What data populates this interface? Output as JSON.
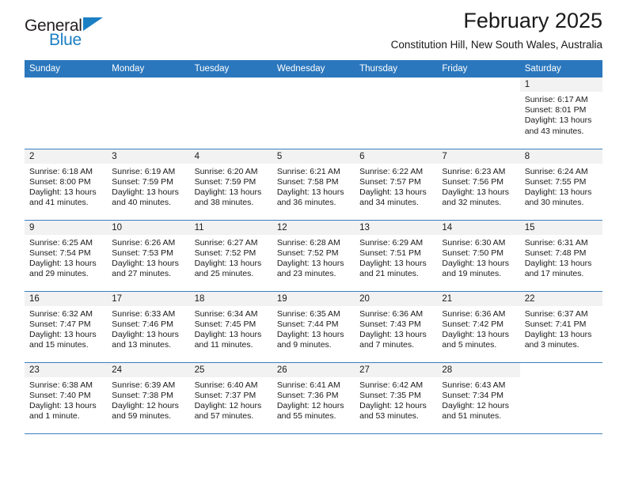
{
  "brand": {
    "name_top": "General",
    "name_bottom": "Blue",
    "flag_color": "#1b7fc4"
  },
  "header": {
    "title": "February 2025",
    "subtitle": "Constitution Hill, New South Wales, Australia"
  },
  "theme": {
    "header_row_bg": "#2b77bd",
    "daynum_bg": "#f2f2f2",
    "row_border": "#3a7fc0"
  },
  "weekday_headers": [
    "Sunday",
    "Monday",
    "Tuesday",
    "Wednesday",
    "Thursday",
    "Friday",
    "Saturday"
  ],
  "labels": {
    "sunrise_prefix": "Sunrise:",
    "sunset_prefix": "Sunset:",
    "daylight_prefix": "Daylight:"
  },
  "weeks": [
    [
      {
        "day": "",
        "blank": true
      },
      {
        "day": "",
        "blank": true
      },
      {
        "day": "",
        "blank": true
      },
      {
        "day": "",
        "blank": true
      },
      {
        "day": "",
        "blank": true
      },
      {
        "day": "",
        "blank": true
      },
      {
        "day": "1",
        "sunrise": "Sunrise: 6:17 AM",
        "sunset": "Sunset: 8:01 PM",
        "daylight": "Daylight: 13 hours and 43 minutes."
      }
    ],
    [
      {
        "day": "2",
        "sunrise": "Sunrise: 6:18 AM",
        "sunset": "Sunset: 8:00 PM",
        "daylight": "Daylight: 13 hours and 41 minutes."
      },
      {
        "day": "3",
        "sunrise": "Sunrise: 6:19 AM",
        "sunset": "Sunset: 7:59 PM",
        "daylight": "Daylight: 13 hours and 40 minutes."
      },
      {
        "day": "4",
        "sunrise": "Sunrise: 6:20 AM",
        "sunset": "Sunset: 7:59 PM",
        "daylight": "Daylight: 13 hours and 38 minutes."
      },
      {
        "day": "5",
        "sunrise": "Sunrise: 6:21 AM",
        "sunset": "Sunset: 7:58 PM",
        "daylight": "Daylight: 13 hours and 36 minutes."
      },
      {
        "day": "6",
        "sunrise": "Sunrise: 6:22 AM",
        "sunset": "Sunset: 7:57 PM",
        "daylight": "Daylight: 13 hours and 34 minutes."
      },
      {
        "day": "7",
        "sunrise": "Sunrise: 6:23 AM",
        "sunset": "Sunset: 7:56 PM",
        "daylight": "Daylight: 13 hours and 32 minutes."
      },
      {
        "day": "8",
        "sunrise": "Sunrise: 6:24 AM",
        "sunset": "Sunset: 7:55 PM",
        "daylight": "Daylight: 13 hours and 30 minutes."
      }
    ],
    [
      {
        "day": "9",
        "sunrise": "Sunrise: 6:25 AM",
        "sunset": "Sunset: 7:54 PM",
        "daylight": "Daylight: 13 hours and 29 minutes."
      },
      {
        "day": "10",
        "sunrise": "Sunrise: 6:26 AM",
        "sunset": "Sunset: 7:53 PM",
        "daylight": "Daylight: 13 hours and 27 minutes."
      },
      {
        "day": "11",
        "sunrise": "Sunrise: 6:27 AM",
        "sunset": "Sunset: 7:52 PM",
        "daylight": "Daylight: 13 hours and 25 minutes."
      },
      {
        "day": "12",
        "sunrise": "Sunrise: 6:28 AM",
        "sunset": "Sunset: 7:52 PM",
        "daylight": "Daylight: 13 hours and 23 minutes."
      },
      {
        "day": "13",
        "sunrise": "Sunrise: 6:29 AM",
        "sunset": "Sunset: 7:51 PM",
        "daylight": "Daylight: 13 hours and 21 minutes."
      },
      {
        "day": "14",
        "sunrise": "Sunrise: 6:30 AM",
        "sunset": "Sunset: 7:50 PM",
        "daylight": "Daylight: 13 hours and 19 minutes."
      },
      {
        "day": "15",
        "sunrise": "Sunrise: 6:31 AM",
        "sunset": "Sunset: 7:48 PM",
        "daylight": "Daylight: 13 hours and 17 minutes."
      }
    ],
    [
      {
        "day": "16",
        "sunrise": "Sunrise: 6:32 AM",
        "sunset": "Sunset: 7:47 PM",
        "daylight": "Daylight: 13 hours and 15 minutes."
      },
      {
        "day": "17",
        "sunrise": "Sunrise: 6:33 AM",
        "sunset": "Sunset: 7:46 PM",
        "daylight": "Daylight: 13 hours and 13 minutes."
      },
      {
        "day": "18",
        "sunrise": "Sunrise: 6:34 AM",
        "sunset": "Sunset: 7:45 PM",
        "daylight": "Daylight: 13 hours and 11 minutes."
      },
      {
        "day": "19",
        "sunrise": "Sunrise: 6:35 AM",
        "sunset": "Sunset: 7:44 PM",
        "daylight": "Daylight: 13 hours and 9 minutes."
      },
      {
        "day": "20",
        "sunrise": "Sunrise: 6:36 AM",
        "sunset": "Sunset: 7:43 PM",
        "daylight": "Daylight: 13 hours and 7 minutes."
      },
      {
        "day": "21",
        "sunrise": "Sunrise: 6:36 AM",
        "sunset": "Sunset: 7:42 PM",
        "daylight": "Daylight: 13 hours and 5 minutes."
      },
      {
        "day": "22",
        "sunrise": "Sunrise: 6:37 AM",
        "sunset": "Sunset: 7:41 PM",
        "daylight": "Daylight: 13 hours and 3 minutes."
      }
    ],
    [
      {
        "day": "23",
        "sunrise": "Sunrise: 6:38 AM",
        "sunset": "Sunset: 7:40 PM",
        "daylight": "Daylight: 13 hours and 1 minute."
      },
      {
        "day": "24",
        "sunrise": "Sunrise: 6:39 AM",
        "sunset": "Sunset: 7:38 PM",
        "daylight": "Daylight: 12 hours and 59 minutes."
      },
      {
        "day": "25",
        "sunrise": "Sunrise: 6:40 AM",
        "sunset": "Sunset: 7:37 PM",
        "daylight": "Daylight: 12 hours and 57 minutes."
      },
      {
        "day": "26",
        "sunrise": "Sunrise: 6:41 AM",
        "sunset": "Sunset: 7:36 PM",
        "daylight": "Daylight: 12 hours and 55 minutes."
      },
      {
        "day": "27",
        "sunrise": "Sunrise: 6:42 AM",
        "sunset": "Sunset: 7:35 PM",
        "daylight": "Daylight: 12 hours and 53 minutes."
      },
      {
        "day": "28",
        "sunrise": "Sunrise: 6:43 AM",
        "sunset": "Sunset: 7:34 PM",
        "daylight": "Daylight: 12 hours and 51 minutes."
      },
      {
        "day": "",
        "blank": true
      }
    ]
  ]
}
